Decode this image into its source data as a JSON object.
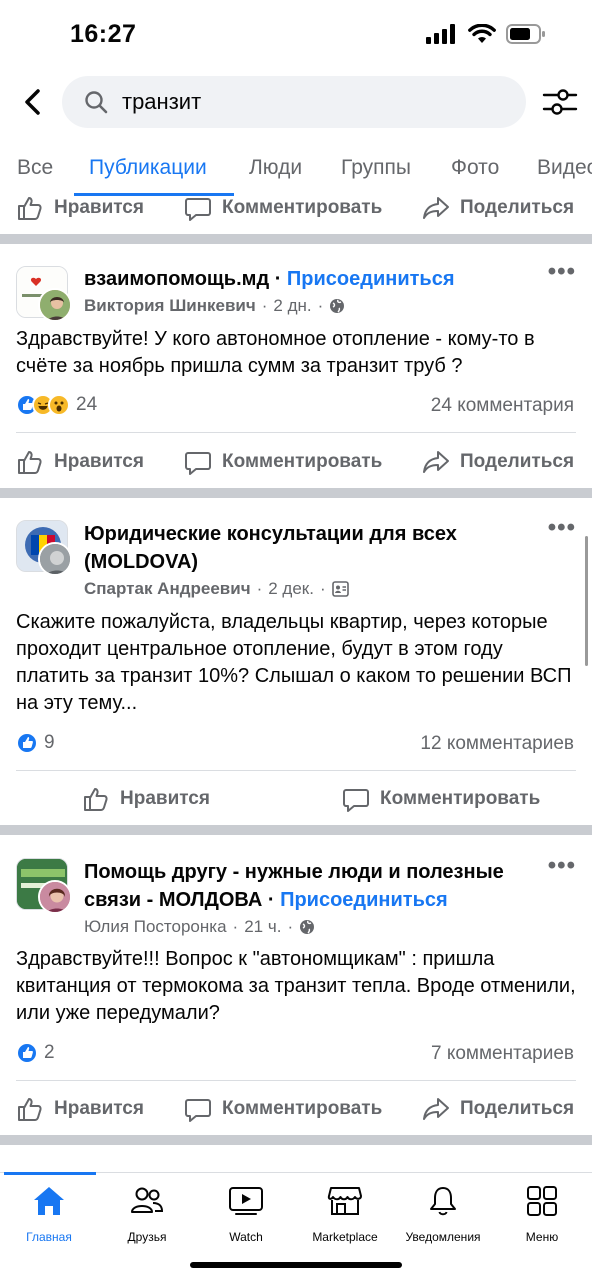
{
  "status": {
    "time": "16:27"
  },
  "search": {
    "query": "транзит"
  },
  "tabs": [
    {
      "label": "Все"
    },
    {
      "label": "Публикации"
    },
    {
      "label": "Люди"
    },
    {
      "label": "Группы"
    },
    {
      "label": "Фото"
    },
    {
      "label": "Видео"
    }
  ],
  "actions": {
    "like": "Нравится",
    "comment": "Комментировать",
    "share": "Поделиться"
  },
  "posts": [
    {
      "group": "взаимопомощь.мд",
      "join": "Присоединиться",
      "separator": " · ",
      "author": "Виктория Шинкевич",
      "time": "2 дн.",
      "text": "Здравствуйте! У кого автономное отопление - кому-то в счёте за ноябрь пришла сумм за транзит труб ?",
      "reactions": "24",
      "comments": "24 комментария"
    },
    {
      "group": "Юридические консультации для всех (MOLDOVA)",
      "author": "Спартак Андреевич",
      "time": "2 дек.",
      "text": "Скажите пожалуйста, владельцы квартир, через которые проходит центральное отопление, будут в этом году платить за транзит 10%?  Слышал о каком то решении ВСП на эту тему...",
      "reactions": "9",
      "comments": "12 комментариев"
    },
    {
      "group": "Помощь другу - нужные люди и полезные связи - МОЛДОВА",
      "join": "Присоединиться",
      "separator": " · ",
      "author": "Юлия Посторонка",
      "time": "21 ч.",
      "text": "Здравствуйте!!! Вопрос к \"автономщикам\" : пришла квитанция от термокома за транзит тепла. Вроде отменили, или уже передумали?",
      "reactions": "2",
      "comments": "7 комментариев"
    }
  ],
  "nav": [
    {
      "label": "Главная",
      "icon": "home-icon"
    },
    {
      "label": "Друзья",
      "icon": "friends-icon"
    },
    {
      "label": "Watch",
      "icon": "watch-icon"
    },
    {
      "label": "Marketplace",
      "icon": "marketplace-icon"
    },
    {
      "label": "Уведомления",
      "icon": "bell-icon"
    },
    {
      "label": "Меню",
      "icon": "menu-grid-icon"
    }
  ],
  "colors": {
    "accent": "#1877f2",
    "secondary_text": "#65676b",
    "divider": "#c9ccd1"
  }
}
